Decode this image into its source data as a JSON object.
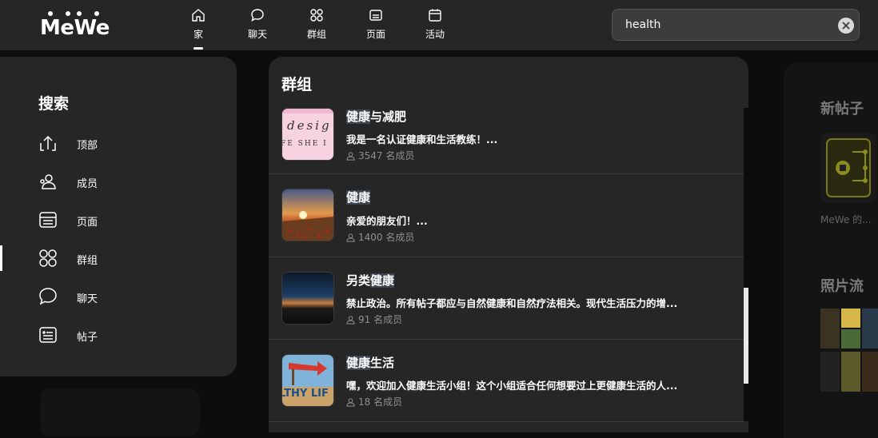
{
  "header": {
    "logo_text": "MeWe",
    "nav": [
      {
        "label": "家",
        "icon": "home-icon",
        "active": true
      },
      {
        "label": "聊天",
        "icon": "chat-icon",
        "active": false
      },
      {
        "label": "群组",
        "icon": "groups-icon",
        "active": false
      },
      {
        "label": "页面",
        "icon": "pages-icon",
        "active": false
      },
      {
        "label": "活动",
        "icon": "calendar-icon",
        "active": false
      }
    ],
    "search": {
      "value": "health",
      "clear_icon": "close-circle-icon"
    }
  },
  "sidebar": {
    "title": "搜索",
    "items": [
      {
        "label": "顶部",
        "icon": "upload-arrow-icon",
        "active": false
      },
      {
        "label": "成员",
        "icon": "members-icon",
        "active": false
      },
      {
        "label": "页面",
        "icon": "pages-icon",
        "active": false
      },
      {
        "label": "群组",
        "icon": "groups-icon",
        "active": true
      },
      {
        "label": "聊天",
        "icon": "chat-icon",
        "active": false
      },
      {
        "label": "帖子",
        "icon": "post-icon",
        "active": false
      }
    ]
  },
  "main": {
    "title": "群组",
    "results": [
      {
        "name_highlight": "健康",
        "name_rest": "与减肥",
        "description": "我是一名认证健康和生活教练！...",
        "members": "3547 名成员",
        "thumb_text": "desig"
      },
      {
        "name_highlight": "健康",
        "name_rest": "",
        "description": "亲爱的朋友们！...",
        "members": "1400 名成员"
      },
      {
        "name_prefix": "另类",
        "name_highlight": "健康",
        "name_rest": "",
        "description": "禁止政治。所有帖子都应与自然健康和自然疗法相关。现代生活压力的增...",
        "members": "91 名成员"
      },
      {
        "name_highlight": "健康",
        "name_rest": "生活",
        "description": "嘿，欢迎加入健康生活小组！这个小组适合任何想要过上更健康生活的人...",
        "members": "18 名成员",
        "thumb_text": "LTHY LIF"
      }
    ]
  },
  "right_panel": {
    "new_posts_title": "新帖子",
    "new_post_caption": "MeWe 的...",
    "photo_stream_title": "照片流"
  },
  "colors": {
    "topbar": "#262626",
    "panel": "#262626",
    "background": "#0d0d0d",
    "highlight": "#3b4651"
  }
}
